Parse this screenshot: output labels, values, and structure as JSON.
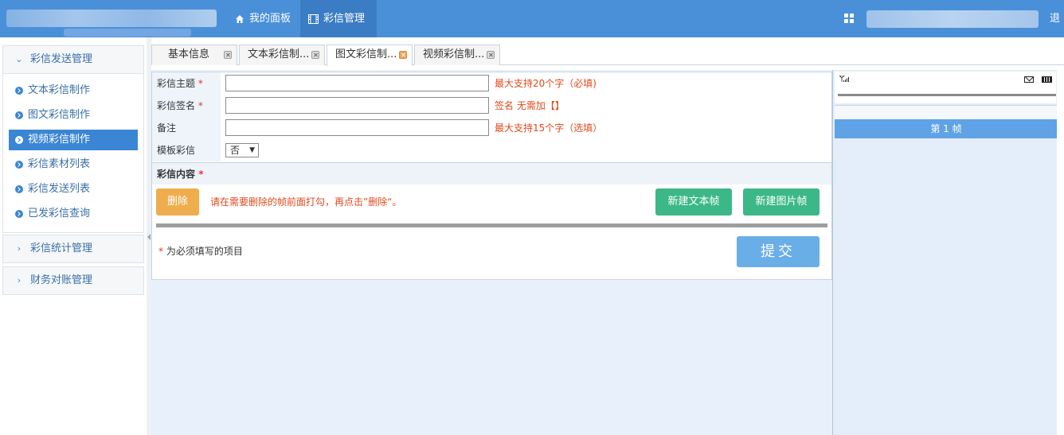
{
  "topbar": {
    "nav": [
      {
        "label": "我的面板",
        "icon": "home-icon"
      },
      {
        "label": "彩信管理",
        "icon": "film-icon"
      }
    ],
    "logout_label": "退"
  },
  "sidebar": {
    "sections": [
      {
        "title": "彩信发送管理",
        "expanded": true,
        "items": [
          {
            "label": "文本彩信制作",
            "active": false
          },
          {
            "label": "图文彩信制作",
            "active": false
          },
          {
            "label": "视频彩信制作",
            "active": true
          },
          {
            "label": "彩信素材列表",
            "active": false
          },
          {
            "label": "彩信发送列表",
            "active": false
          },
          {
            "label": "已发彩信查询",
            "active": false
          }
        ]
      },
      {
        "title": "彩信统计管理",
        "expanded": false
      },
      {
        "title": "财务对账管理",
        "expanded": false
      }
    ]
  },
  "tabs": [
    {
      "label": "基本信息",
      "active": false
    },
    {
      "label": "文本彩信制...",
      "active": false
    },
    {
      "label": "图文彩信制...",
      "active": true
    },
    {
      "label": "视频彩信制...",
      "active": false
    }
  ],
  "form": {
    "subject": {
      "label": "彩信主题",
      "required": "*",
      "value": "",
      "hint": "最大支持20个字（必填)"
    },
    "signature": {
      "label": "彩信签名",
      "required": "*",
      "value": "",
      "hint": "签名 无需加【】"
    },
    "remark": {
      "label": "备注",
      "value": "",
      "hint": "最大支持15个字（选填）"
    },
    "template": {
      "label": "模板彩信",
      "selected": "否"
    },
    "content_section": {
      "label": "彩信内容",
      "required": "*"
    },
    "delete_button": "删除",
    "delete_hint": "请在需要删除的帧前面打勾，再点击”删除“。",
    "new_text_frame_button": "新建文本帧",
    "new_image_frame_button": "新建图片帧",
    "required_note_star": "*",
    "required_note": " 为必须填写的项目",
    "submit_button": "提交"
  },
  "preview": {
    "frame_label": "第 1 帧"
  },
  "colors": {
    "topbar": "#4a90d9",
    "active_menu": "#3a86d4",
    "hint_text": "#e04a1c",
    "delete_button": "#f0ad4e",
    "green_button": "#3cb888",
    "submit_button": "#6aaee8"
  }
}
